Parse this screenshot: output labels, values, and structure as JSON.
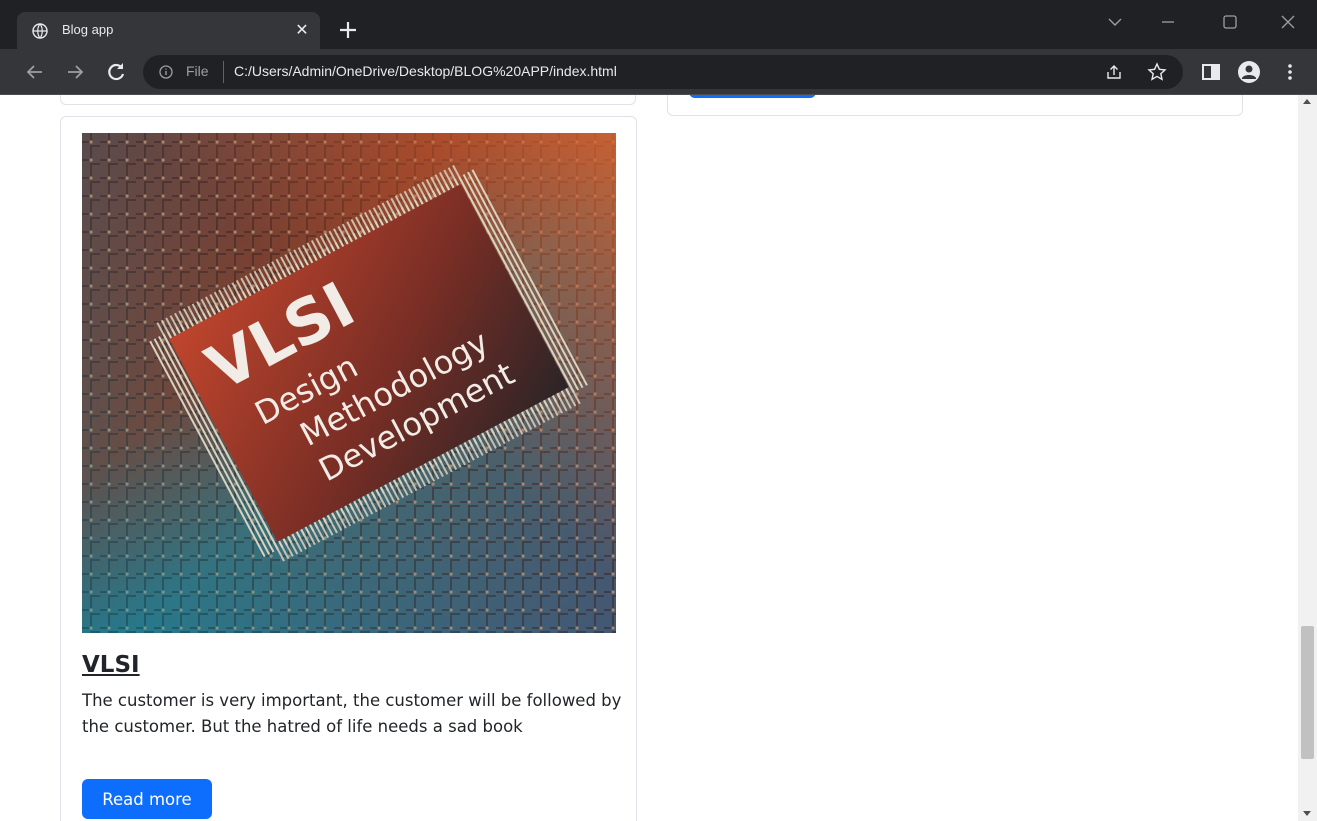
{
  "browser": {
    "tab_title": "Blog app",
    "omnibox_scheme": "File",
    "url": "C:/Users/Admin/OneDrive/Desktop/BLOG%20APP/index.html"
  },
  "icons": {
    "tab_favicon": "globe-icon",
    "tab_close": "close-icon",
    "new_tab": "plus-icon",
    "back": "arrow-left-icon",
    "forward": "arrow-right-icon",
    "reload": "reload-icon",
    "site_info": "info-icon",
    "share": "share-icon",
    "bookmark": "star-icon",
    "side_panel": "side-panel-icon",
    "profile": "profile-icon",
    "menu": "kebab-menu-icon"
  },
  "card": {
    "image_overlay": {
      "line1": "VLSI",
      "line2": "Design",
      "line3": "Methodology",
      "line4": "Development"
    },
    "title": "VLSI",
    "text": "The customer is very important, the customer will be followed by the customer. But the hatred of life needs a sad book",
    "button": "Read more"
  },
  "colors": {
    "primary": "#0d6efd",
    "chrome_dark": "#202124",
    "chrome_tab": "#35363a"
  }
}
